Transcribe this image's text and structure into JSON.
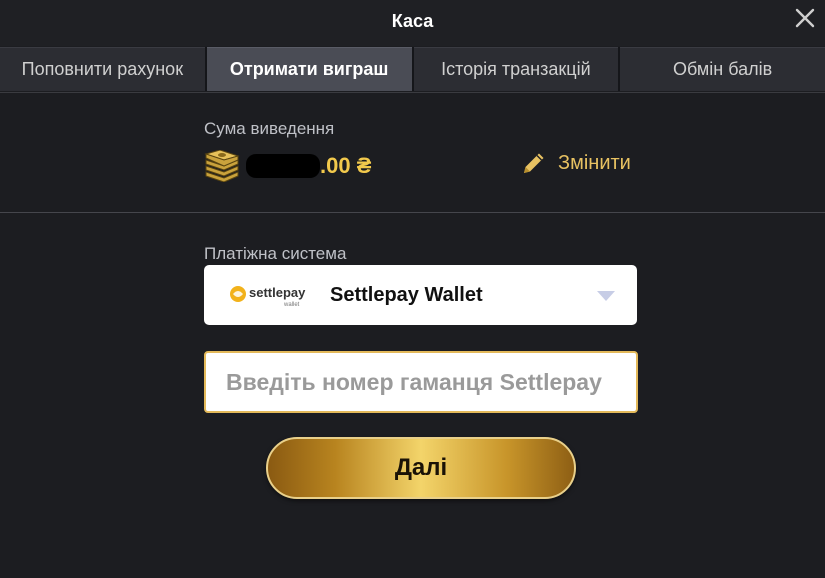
{
  "window": {
    "title": "Каса"
  },
  "icons": {
    "close": "close-icon",
    "money": "money-stack-icon",
    "edit": "pencil-icon",
    "dropdown": "chevron-down-icon",
    "brand": "settlepay-logo"
  },
  "colors": {
    "accent": "#e8c262",
    "amount": "#f2c94c",
    "background": "#1c1d21",
    "active_tab": "#4a4c55"
  },
  "tabs": [
    {
      "label": "Поповнити рахунок",
      "active": false
    },
    {
      "label": "Отримати виграш",
      "active": true
    },
    {
      "label": "Історія транзакцій",
      "active": false
    },
    {
      "label": "Обмін балів",
      "active": false
    }
  ],
  "withdrawal": {
    "label": "Сума виведення",
    "amount_suffix": ".00 ₴",
    "change_label": "Змінити"
  },
  "payment": {
    "label": "Платіжна система",
    "selected": "Settlepay Wallet",
    "logo_text": "settlepay",
    "logo_subtext": "wallet"
  },
  "wallet_input": {
    "placeholder": "Введіть номер гаманця Settlepay",
    "value": ""
  },
  "submit": {
    "label": "Далі"
  }
}
